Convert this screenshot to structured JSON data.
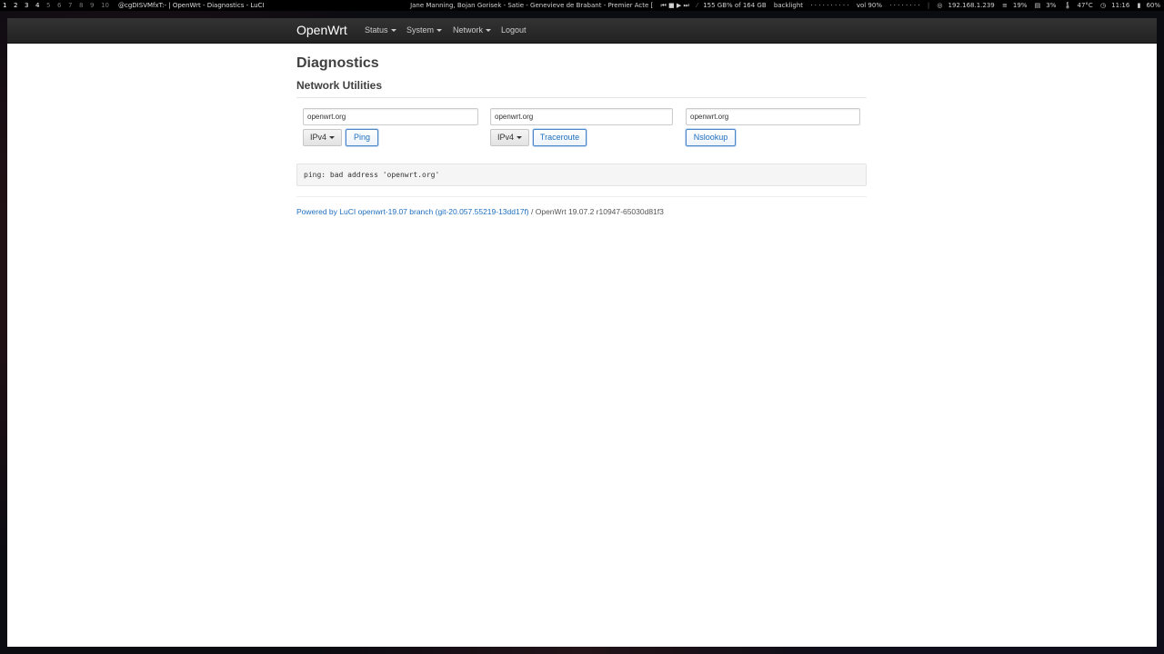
{
  "topbar": {
    "workspaces": [
      "1",
      "2",
      "3",
      "4",
      "5",
      "6",
      "7",
      "8",
      "9",
      "10"
    ],
    "window_title": "@cgDISVMfxT:- | OpenWrt - Diagnostics - LuCI",
    "now_playing": "Jane Manning, Bojan Gorisek - Satie - Genevieve de Brabant - Premier Acte [",
    "media_controls": "⏮ ■ ▶ ⏭",
    "disk": "155 GB% of 164 GB",
    "backlight": "backlight",
    "backlight_dots": "· · · · · · · · · ·",
    "volume": "vol 90%",
    "volume_dots": "· · · · · · · ·",
    "ip": "192.168.1.239",
    "cpu": "19%",
    "mem": "3%",
    "temp": "47°C",
    "time": "11:16",
    "battery": "60%"
  },
  "navbar": {
    "brand": "OpenWrt",
    "items": [
      {
        "label": "Status",
        "dropdown": true
      },
      {
        "label": "System",
        "dropdown": true
      },
      {
        "label": "Network",
        "dropdown": true
      },
      {
        "label": "Logout",
        "dropdown": false
      }
    ]
  },
  "page": {
    "title": "Diagnostics",
    "section_title": "Network Utilities"
  },
  "tools": {
    "ping": {
      "host": "openwrt.org",
      "protocol": "IPv4",
      "button": "Ping"
    },
    "traceroute": {
      "host": "openwrt.org",
      "protocol": "IPv4",
      "button": "Traceroute"
    },
    "nslookup": {
      "host": "openwrt.org",
      "button": "Nslookup"
    }
  },
  "output": "ping: bad address 'openwrt.org'",
  "footer": {
    "powered_by": "Powered by LuCI openwrt-19.07 branch (git-20.057.55219-13dd17f)",
    "separator": " / ",
    "version": "OpenWrt 19.07.2 r10947-65030d81f3"
  }
}
